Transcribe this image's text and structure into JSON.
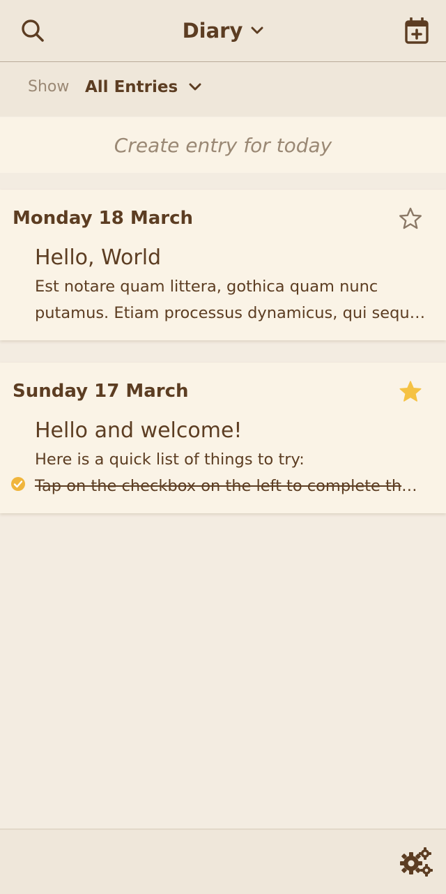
{
  "header": {
    "title": "Diary",
    "search_icon": "search-icon",
    "calendar_icon": "calendar-add-icon",
    "title_dropdown_icon": "chevron-down-icon"
  },
  "filter": {
    "label": "Show",
    "value": "All Entries"
  },
  "create_entry": {
    "label": "Create entry for today"
  },
  "entries": [
    {
      "date": "Monday 18 March",
      "starred": false,
      "title": "Hello, World",
      "lines": [
        "Est notare quam littera, gothica quam nunc",
        "putamus. Etiam processus dynamicus, qui sequitur mutationem consuetudium lectorum."
      ]
    },
    {
      "date": "Sunday 17 March",
      "starred": true,
      "title": "Hello and welcome!",
      "lines": [
        "Here is a quick list of things to try:",
        "Tap on the checkbox on the left to complete the task"
      ],
      "checked_line_index": 1
    }
  ],
  "footer": {
    "settings_icon": "gears-icon"
  },
  "colors": {
    "background": "#f3ece1",
    "bar": "#efe7da",
    "card": "#faf3e6",
    "text": "#5c3d22",
    "muted": "#9a8874",
    "star_active": "#f5c243",
    "check": "#f0b53c"
  }
}
